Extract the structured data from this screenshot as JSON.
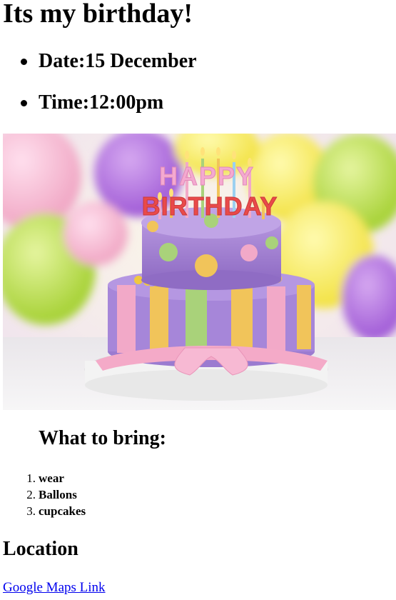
{
  "page": {
    "title": "Its my birthday!",
    "details": [
      {
        "label": "Date:",
        "value": "15 December"
      },
      {
        "label": "Time:",
        "value": "12:00pm"
      }
    ],
    "image": {
      "alt": "birthday cake",
      "topper_line1": "HAPPY",
      "topper_line2": "BIRTHDAY"
    },
    "bring": {
      "heading": "What to bring:",
      "items": [
        {
          "num": "1.",
          "text": "wear"
        },
        {
          "num": "2.",
          "text": "Ballons"
        },
        {
          "num": "3.",
          "text": "cupcakes"
        }
      ]
    },
    "location": {
      "heading": "Location",
      "link_text": "Google Maps Link"
    }
  },
  "colors": {
    "text": "#000000",
    "link": "#0000ee",
    "cake_purple": "#9b7bd0",
    "cake_pink": "#f2a9c8",
    "cake_yellow": "#f1c45a",
    "cake_green": "#a9d27a"
  }
}
